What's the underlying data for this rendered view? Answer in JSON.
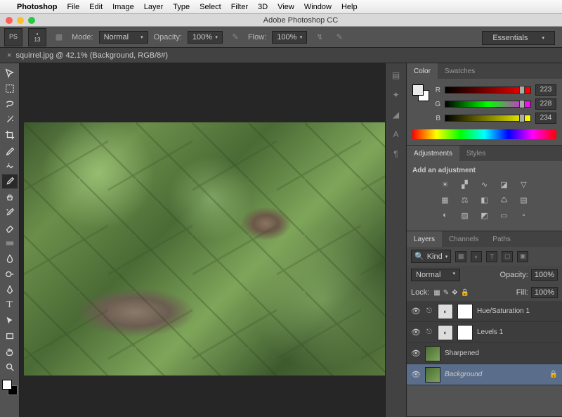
{
  "menubar": {
    "items": [
      "Photoshop",
      "File",
      "Edit",
      "Image",
      "Layer",
      "Type",
      "Select",
      "Filter",
      "3D",
      "View",
      "Window",
      "Help"
    ]
  },
  "window": {
    "title": "Adobe Photoshop CC"
  },
  "workspace": {
    "label": "Essentials"
  },
  "options": {
    "brush_size": "13",
    "mode_label": "Mode:",
    "mode_value": "Normal",
    "opacity_label": "Opacity:",
    "opacity_value": "100%",
    "flow_label": "Flow:",
    "flow_value": "100%"
  },
  "document": {
    "tab": "squirrel.jpg @ 42.1% (Background, RGB/8#)"
  },
  "panels": {
    "color": {
      "tabs": [
        "Color",
        "Swatches"
      ],
      "r": "223",
      "g": "228",
      "b": "234"
    },
    "adjustments": {
      "tabs": [
        "Adjustments",
        "Styles"
      ],
      "title": "Add an adjustment"
    },
    "layers": {
      "tabs": [
        "Layers",
        "Channels",
        "Paths"
      ],
      "filter": "Kind",
      "blend": "Normal",
      "opacity_label": "Opacity:",
      "opacity_value": "100%",
      "lock_label": "Lock:",
      "fill_label": "Fill:",
      "fill_value": "100%",
      "items": [
        {
          "name": "Hue/Saturation 1",
          "type": "adj"
        },
        {
          "name": "Levels 1",
          "type": "adj"
        },
        {
          "name": "Sharpened",
          "type": "img"
        },
        {
          "name": "Background",
          "type": "img",
          "locked": true,
          "selected": true,
          "italic": true
        }
      ]
    }
  },
  "labels": {
    "r": "R",
    "g": "G",
    "b": "B"
  }
}
